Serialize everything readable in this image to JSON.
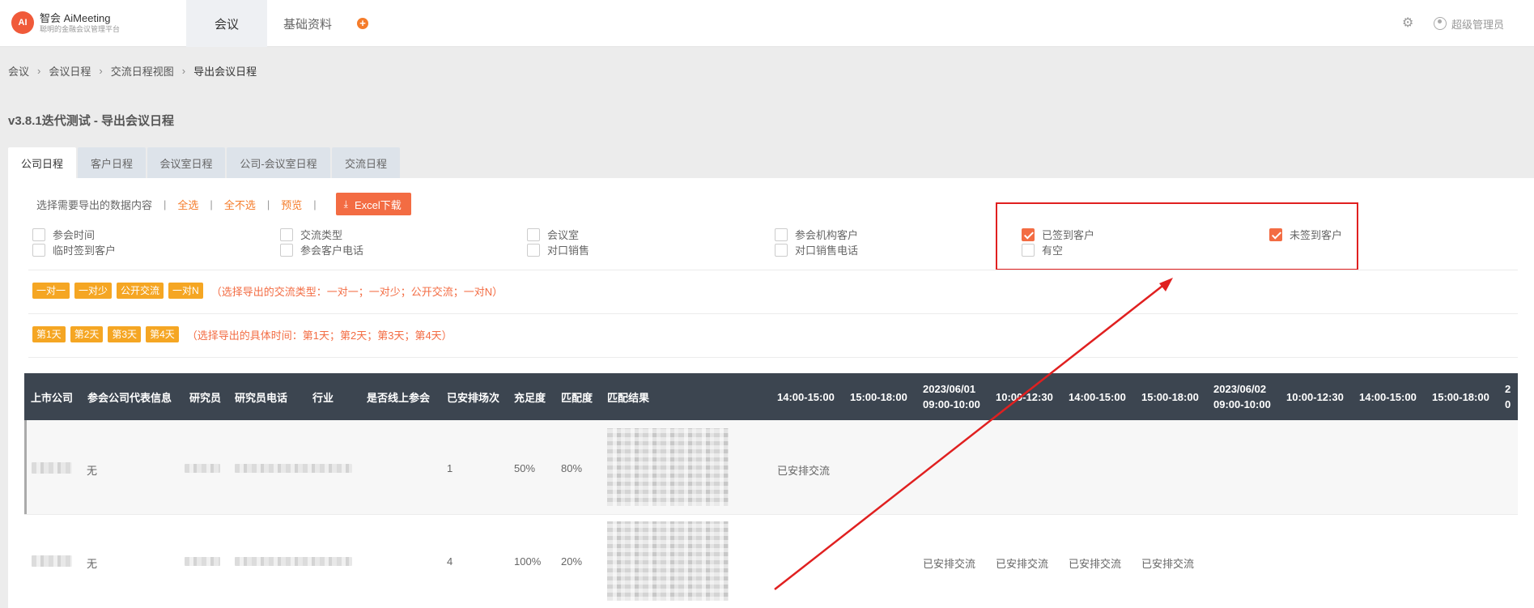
{
  "header": {
    "logo_mark": "AI",
    "logo_title": "智会 AiMeeting",
    "logo_sub": "聪明的金融会议管理平台",
    "nav": [
      {
        "label": "会议",
        "active": true
      },
      {
        "label": "基础资料",
        "active": false
      }
    ],
    "plus_icon": "plus-circle-icon",
    "gear_icon": "gear-icon",
    "user_icon": "user-circle-icon",
    "user_name": "超级管理员"
  },
  "breadcrumb": [
    "会议",
    "会议日程",
    "交流日程视图",
    "导出会议日程"
  ],
  "page_title": "v3.8.1迭代测试 - 导出会议日程",
  "tabs": [
    "公司日程",
    "客户日程",
    "会议室日程",
    "公司-会议室日程",
    "交流日程"
  ],
  "toolbar": {
    "label": "选择需要导出的数据内容",
    "select_all": "全选",
    "select_none": "全不选",
    "preview": "预览",
    "excel": "Excel下载",
    "sep": "|"
  },
  "fields": [
    {
      "label": "参会时间",
      "checked": false
    },
    {
      "label": "交流类型",
      "checked": false
    },
    {
      "label": "会议室",
      "checked": false
    },
    {
      "label": "参会机构客户",
      "checked": false
    },
    {
      "label": "已签到客户",
      "checked": true
    },
    {
      "label": "未签到客户",
      "checked": true
    },
    {
      "label": "临时签到客户",
      "checked": false
    },
    {
      "label": "参会客户电话",
      "checked": false
    },
    {
      "label": "对口销售",
      "checked": false
    },
    {
      "label": "对口销售电话",
      "checked": false
    },
    {
      "label": "有空",
      "checked": false
    }
  ],
  "types": {
    "tags": [
      "一对一",
      "一对少",
      "公开交流",
      "一对N"
    ],
    "hint": "（选择导出的交流类型：一对一；一对少；公开交流；一对N）"
  },
  "days": {
    "tags": [
      "第1天",
      "第2天",
      "第3天",
      "第4天"
    ],
    "hint": "（选择导出的具体时间：第1天；第2天；第3天；第4天）"
  },
  "table": {
    "headers": [
      "上市公司",
      "参会公司代表信息",
      "研究员",
      "研究员电话",
      "行业",
      "是否线上参会",
      "已安排场次",
      "充足度",
      "匹配度",
      "匹配结果"
    ],
    "slots": [
      {
        "date": "",
        "time": "14:00-15:00"
      },
      {
        "date": "",
        "time": "15:00-18:00"
      },
      {
        "date": "2023/06/01",
        "time": "09:00-10:00"
      },
      {
        "date": "",
        "time": "10:00-12:30"
      },
      {
        "date": "",
        "time": "14:00-15:00"
      },
      {
        "date": "",
        "time": "15:00-18:00"
      },
      {
        "date": "2023/06/02",
        "time": "09:00-10:00"
      },
      {
        "date": "",
        "time": "10:00-12:30"
      },
      {
        "date": "",
        "time": "14:00-15:00"
      },
      {
        "date": "",
        "time": "15:00-18:00"
      },
      {
        "date": "2",
        "time": "0"
      }
    ],
    "rows": [
      {
        "rep": "无",
        "count": "1",
        "sufficiency": "50%",
        "match": "80%",
        "slots": [
          "已安排交流",
          "",
          "",
          "",
          "",
          "",
          "",
          "",
          "",
          ""
        ]
      },
      {
        "rep": "无",
        "count": "4",
        "sufficiency": "100%",
        "match": "20%",
        "slots": [
          "",
          "",
          "已安排交流",
          "已安排交流",
          "已安排交流",
          "已安排交流",
          "",
          "",
          "",
          ""
        ]
      }
    ]
  },
  "colors": {
    "accent": "#f36c43",
    "tag": "#f5a623",
    "table_header": "#3c4550",
    "annotation": "#e02020"
  }
}
